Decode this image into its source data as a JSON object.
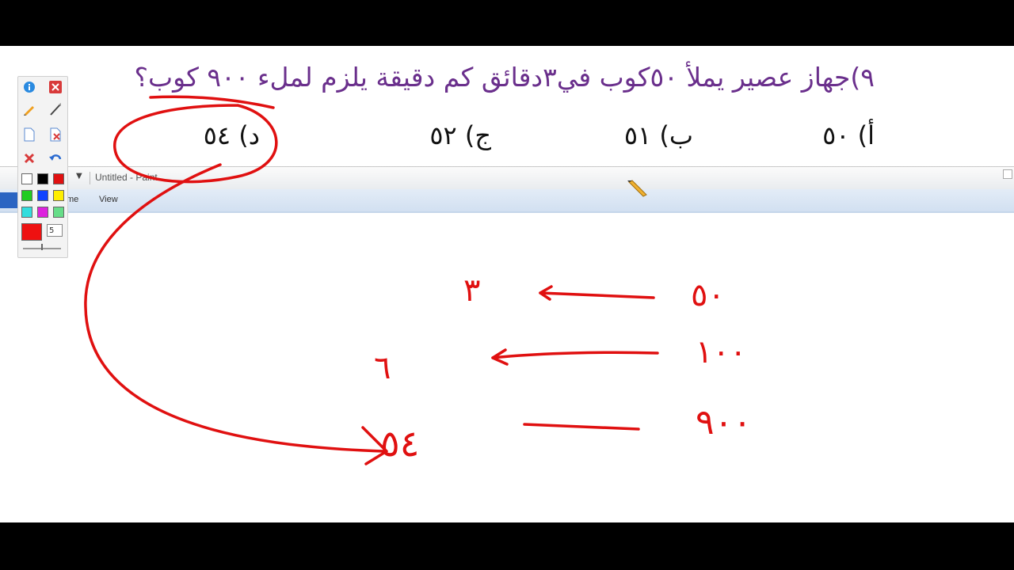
{
  "question": {
    "text": "٩)جهاز عصير يملأ ٥٠كوب في٣دقائق كم دقيقة يلزم لملء ٩٠٠ كوب؟",
    "color": "#6a2f8c"
  },
  "choices": [
    {
      "label": "أ) ٥٠"
    },
    {
      "label": "ب) ٥١"
    },
    {
      "label": "ج) ٥٢"
    },
    {
      "label": "د) ٥٤"
    }
  ],
  "paint_window": {
    "title": "Untitled - Paint",
    "tabs": [
      "Home",
      "View"
    ],
    "visible_tab_fragment": "me"
  },
  "pen_toolbar": {
    "icons": [
      "info-icon",
      "close-icon",
      "pencil-icon",
      "pen-icon",
      "new-page-icon",
      "delete-page-icon",
      "clear-icon",
      "undo-icon"
    ],
    "palette": [
      "#ffffff",
      "#000000",
      "#e01010",
      "#22cc22",
      "#1144ff",
      "#ffee00",
      "#33dddd",
      "#dd22dd",
      "#66dd88"
    ],
    "current_color": "#ee1111",
    "pen_size": "5"
  },
  "handwriting": {
    "color": "#e01010",
    "rows": [
      {
        "left": "٥٠",
        "right": "٣"
      },
      {
        "left": "١٠٠",
        "right": "٦"
      },
      {
        "left": "٩٠٠",
        "right": "٥٤"
      }
    ]
  }
}
